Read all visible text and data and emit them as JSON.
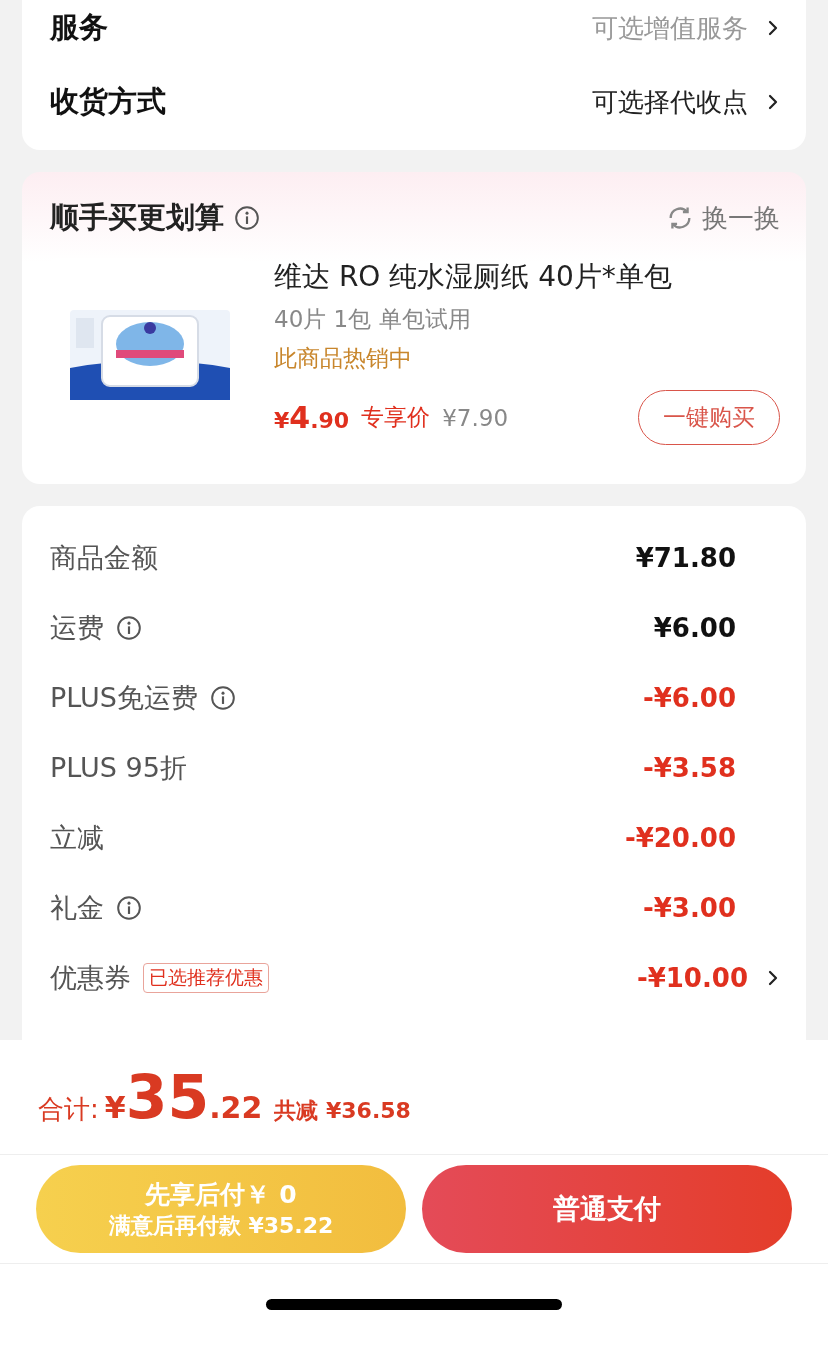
{
  "service_card": {
    "rows": [
      {
        "label": "服务",
        "value": "可选增值服务",
        "muted": true
      },
      {
        "label": "收货方式",
        "value": "可选择代收点",
        "muted": false
      }
    ]
  },
  "addon": {
    "title": "顺手买更划算",
    "refresh": "换一换",
    "product": {
      "name": "维达 RO 纯水湿厕纸 40片*单包",
      "spec": "40片 1包 单包试用",
      "hot": "此商品热销中",
      "price_symbol": "¥",
      "price_int": "4",
      "price_dec": ".90",
      "price_label": "专享价",
      "original_price": "¥7.90",
      "buy": "一键购买"
    }
  },
  "summary": {
    "rows": [
      {
        "label": "商品金额",
        "info": false,
        "value": "¥71.80",
        "discount": false,
        "chevron": false
      },
      {
        "label": "运费",
        "info": true,
        "value": "¥6.00",
        "discount": false,
        "chevron": false
      },
      {
        "label": "PLUS免运费",
        "info": true,
        "value": "-¥6.00",
        "discount": true,
        "chevron": false
      },
      {
        "label": "PLUS 95折",
        "info": false,
        "value": "-¥3.58",
        "discount": true,
        "chevron": false
      },
      {
        "label": "立减",
        "info": false,
        "value": "-¥20.00",
        "discount": true,
        "chevron": false
      },
      {
        "label": "礼金",
        "info": true,
        "value": "-¥3.00",
        "discount": true,
        "chevron": false
      },
      {
        "label": "优惠券",
        "tag": "已选推荐优惠",
        "info": false,
        "value": "-¥10.00",
        "discount": true,
        "chevron": true
      }
    ]
  },
  "total": {
    "label": "合计:",
    "symbol": "¥",
    "int": "35",
    "dec": ".22",
    "saved": "共减 ¥36.58"
  },
  "buttons": {
    "later": {
      "title": "先享后付￥ 0",
      "subtitle": "满意后再付款 ¥35.22"
    },
    "pay": "普通支付"
  }
}
